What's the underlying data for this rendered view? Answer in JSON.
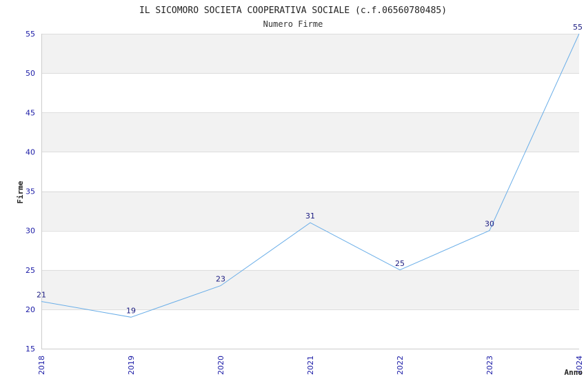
{
  "chart_data": {
    "type": "line",
    "title": "IL SICOMORO SOCIETA COOPERATIVA SOCIALE (c.f.06560780485)",
    "subtitle": "Numero Firme",
    "xlabel": "Anno",
    "ylabel": "Firme",
    "x": [
      "2018",
      "2019",
      "2020",
      "2021",
      "2022",
      "2023",
      "2024"
    ],
    "values": [
      21,
      19,
      23,
      31,
      25,
      30,
      55
    ],
    "ylim": [
      15,
      55
    ],
    "yticks": [
      "15",
      "20",
      "25",
      "30",
      "35",
      "40",
      "45",
      "50",
      "55"
    ],
    "data_labels": [
      "21",
      "19",
      "23",
      "31",
      "25",
      "30",
      "55"
    ],
    "grid": true,
    "colors": {
      "line": "#6aaee8",
      "band": "#f2f2f2",
      "tick_text": "#1a1aa6",
      "label_text": "#1a1a80"
    }
  }
}
